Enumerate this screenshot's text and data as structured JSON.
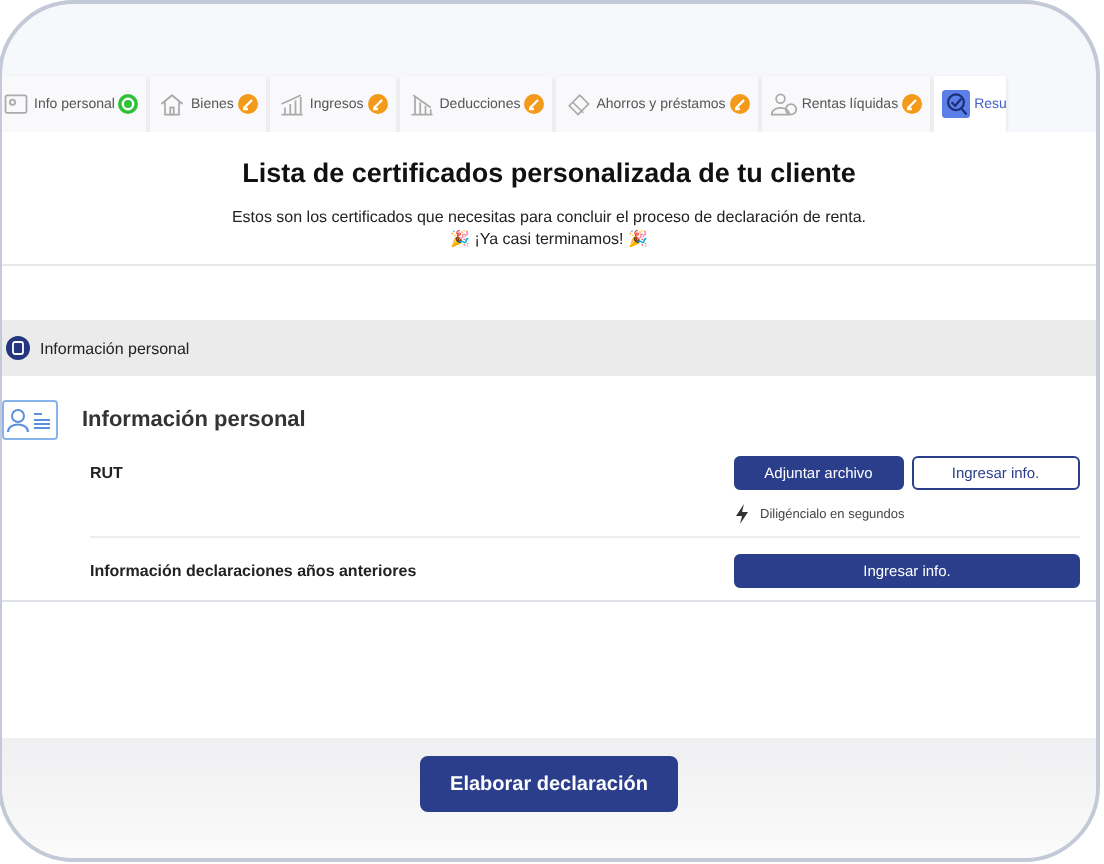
{
  "tabs": [
    {
      "label": "Info personal",
      "kind": "done",
      "selected": false
    },
    {
      "label": "Bienes",
      "kind": "pending",
      "selected": false
    },
    {
      "label": "Ingresos",
      "kind": "pending",
      "selected": false
    },
    {
      "label": "Deducciones",
      "kind": "pending",
      "selected": false
    },
    {
      "label": "Ahorros y préstamos",
      "kind": "pending",
      "selected": false
    },
    {
      "label": "Rentas líquidas",
      "kind": "pending",
      "selected": false
    },
    {
      "label": "Resu",
      "kind": "current",
      "selected": true
    }
  ],
  "title": "Lista de certificados personalizada de tu cliente",
  "subtitle": "Estos son los certificados que necesitas para concluir el proceso de declaración de renta.",
  "cheer": "🎉 ¡Ya casi terminamos! 🎉",
  "section_header": "Información personal",
  "section": {
    "title": "Información personal",
    "items": [
      {
        "label": "RUT",
        "buttons": [
          {
            "label": "Adjuntar archivo",
            "kind": "primary"
          },
          {
            "label": "Ingresar info.",
            "kind": "outline"
          }
        ],
        "hint": "Diligéncialo en segundos"
      },
      {
        "label": "Información declaraciones años anteriores",
        "buttons": [
          {
            "label": "Ingresar info.",
            "kind": "wide"
          }
        ]
      }
    ]
  },
  "main_button": "Elaborar declaración"
}
